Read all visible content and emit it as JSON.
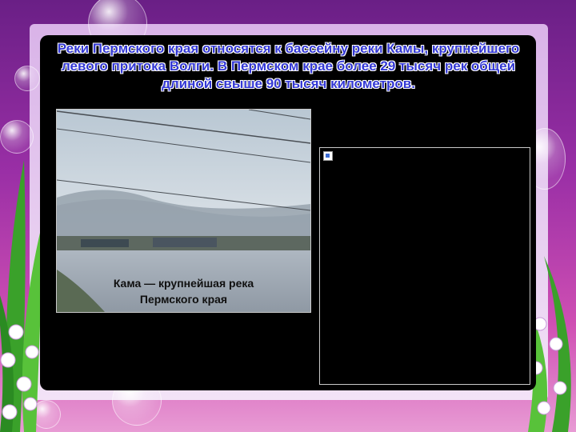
{
  "slide": {
    "title": "Реки Пермского края относятся к бассейну реки Камы, крупнейшего левого притока Волги. В Пермском крае более 29 тысяч рек общей длиной свыше 90 тысяч километров.",
    "photo_caption_line1": "Кама — крупнейшая река",
    "photo_caption_line2": "Пермского края"
  },
  "icons": {
    "broken_image": "broken-image-icon"
  },
  "colors": {
    "title_text": "#3338d4",
    "slide_bg": "#000000",
    "page_bg_top": "#6a1f86"
  }
}
